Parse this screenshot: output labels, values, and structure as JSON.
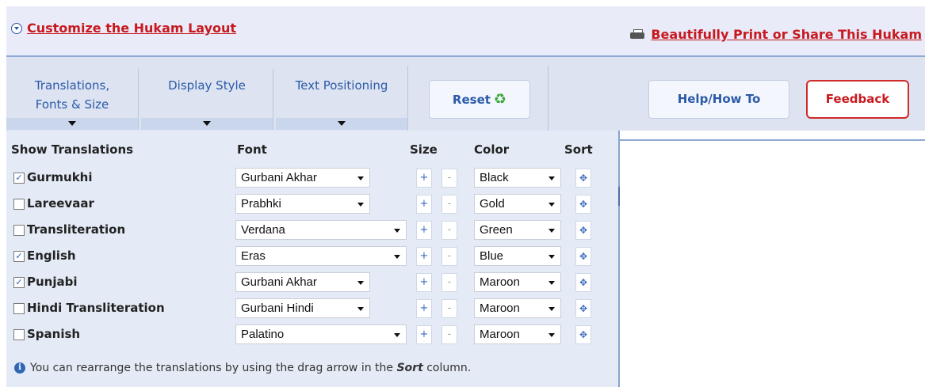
{
  "topbar": {
    "customize_label": "Customize the Hukam Layout",
    "print_label": "Beautifully Print or Share This Hukam"
  },
  "tabs": [
    {
      "label_line1": "Translations,",
      "label_line2": "Fonts & Size"
    },
    {
      "label_line1": "Display Style",
      "label_line2": ""
    },
    {
      "label_line1": "Text Positioning",
      "label_line2": ""
    }
  ],
  "buttons": {
    "reset": "Reset",
    "help": "Help/How To",
    "feedback": "Feedback"
  },
  "table": {
    "headers": {
      "show": "Show Translations",
      "font": "Font",
      "size": "Size",
      "color": "Color",
      "sort": "Sort"
    },
    "rows": [
      {
        "label": "Gurmukhi",
        "checked": true,
        "font": "Gurbani Akhar",
        "color": "Black"
      },
      {
        "label": "Lareevaar",
        "checked": false,
        "font": "Prabhki",
        "color": "Gold"
      },
      {
        "label": "Transliteration",
        "checked": false,
        "font": "Verdana",
        "color": "Green"
      },
      {
        "label": "English",
        "checked": true,
        "font": "Eras",
        "color": "Blue"
      },
      {
        "label": "Punjabi",
        "checked": true,
        "font": "Gurbani Akhar",
        "color": "Maroon"
      },
      {
        "label": "Hindi Transliteration",
        "checked": false,
        "font": "Gurbani Hindi",
        "color": "Maroon"
      },
      {
        "label": "Spanish",
        "checked": false,
        "font": "Palatino",
        "color": "Maroon"
      }
    ],
    "size_plus": "+",
    "size_minus": "-",
    "sort_glyph": "✥"
  },
  "info": {
    "pre": "You can rearrange the translations by using the drag arrow in the",
    "emph": "Sort",
    "post": "column."
  }
}
